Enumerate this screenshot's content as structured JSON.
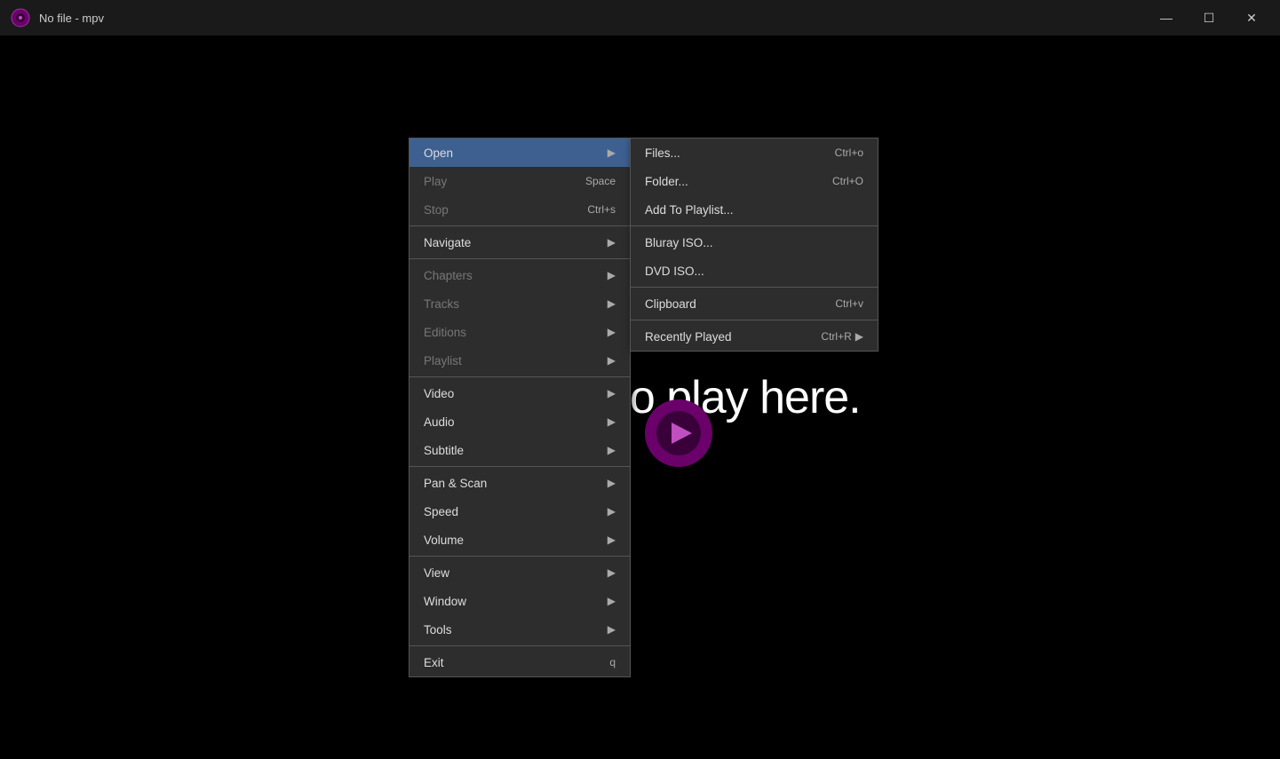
{
  "titlebar": {
    "title": "No file - mpv",
    "minimize": "—",
    "maximize": "☐",
    "close": "✕"
  },
  "main": {
    "drop_text": "Drop files to play here."
  },
  "context_menu": {
    "items": [
      {
        "id": "open",
        "label": "Open",
        "shortcut": "",
        "arrow": true,
        "active": true,
        "disabled": false
      },
      {
        "id": "play",
        "label": "Play",
        "shortcut": "Space",
        "arrow": false,
        "active": false,
        "disabled": true
      },
      {
        "id": "stop",
        "label": "Stop",
        "shortcut": "Ctrl+s",
        "arrow": false,
        "active": false,
        "disabled": true
      },
      {
        "id": "sep1",
        "type": "separator"
      },
      {
        "id": "navigate",
        "label": "Navigate",
        "shortcut": "",
        "arrow": true,
        "active": false,
        "disabled": false
      },
      {
        "id": "sep2",
        "type": "separator"
      },
      {
        "id": "chapters",
        "label": "Chapters",
        "shortcut": "",
        "arrow": true,
        "active": false,
        "disabled": true
      },
      {
        "id": "tracks",
        "label": "Tracks",
        "shortcut": "",
        "arrow": true,
        "active": false,
        "disabled": true
      },
      {
        "id": "editions",
        "label": "Editions",
        "shortcut": "",
        "arrow": true,
        "active": false,
        "disabled": true
      },
      {
        "id": "playlist",
        "label": "Playlist",
        "shortcut": "",
        "arrow": true,
        "active": false,
        "disabled": true
      },
      {
        "id": "sep3",
        "type": "separator"
      },
      {
        "id": "video",
        "label": "Video",
        "shortcut": "",
        "arrow": true,
        "active": false,
        "disabled": false
      },
      {
        "id": "audio",
        "label": "Audio",
        "shortcut": "",
        "arrow": true,
        "active": false,
        "disabled": false
      },
      {
        "id": "subtitle",
        "label": "Subtitle",
        "shortcut": "",
        "arrow": true,
        "active": false,
        "disabled": false
      },
      {
        "id": "sep4",
        "type": "separator"
      },
      {
        "id": "panscan",
        "label": "Pan & Scan",
        "shortcut": "",
        "arrow": true,
        "active": false,
        "disabled": false
      },
      {
        "id": "speed",
        "label": "Speed",
        "shortcut": "",
        "arrow": true,
        "active": false,
        "disabled": false
      },
      {
        "id": "volume",
        "label": "Volume",
        "shortcut": "",
        "arrow": true,
        "active": false,
        "disabled": false
      },
      {
        "id": "sep5",
        "type": "separator"
      },
      {
        "id": "view",
        "label": "View",
        "shortcut": "",
        "arrow": true,
        "active": false,
        "disabled": false
      },
      {
        "id": "window",
        "label": "Window",
        "shortcut": "",
        "arrow": true,
        "active": false,
        "disabled": false
      },
      {
        "id": "tools",
        "label": "Tools",
        "shortcut": "",
        "arrow": true,
        "active": false,
        "disabled": false
      },
      {
        "id": "sep6",
        "type": "separator"
      },
      {
        "id": "exit",
        "label": "Exit",
        "shortcut": "q",
        "arrow": false,
        "active": false,
        "disabled": false
      }
    ]
  },
  "open_submenu": {
    "items": [
      {
        "id": "files",
        "label": "Files...",
        "shortcut": "Ctrl+o",
        "arrow": false
      },
      {
        "id": "folder",
        "label": "Folder...",
        "shortcut": "Ctrl+O",
        "arrow": false
      },
      {
        "id": "addtoplaylist",
        "label": "Add To Playlist...",
        "shortcut": "",
        "arrow": false
      },
      {
        "id": "sep1",
        "type": "separator"
      },
      {
        "id": "bluray",
        "label": "Bluray ISO...",
        "shortcut": "",
        "arrow": false
      },
      {
        "id": "dvd",
        "label": "DVD ISO...",
        "shortcut": "",
        "arrow": false
      },
      {
        "id": "sep2",
        "type": "separator"
      },
      {
        "id": "clipboard",
        "label": "Clipboard",
        "shortcut": "Ctrl+v",
        "arrow": false
      },
      {
        "id": "sep3",
        "type": "separator"
      },
      {
        "id": "recentlyplayed",
        "label": "Recently Played",
        "shortcut": "Ctrl+R",
        "arrow": true
      }
    ]
  }
}
